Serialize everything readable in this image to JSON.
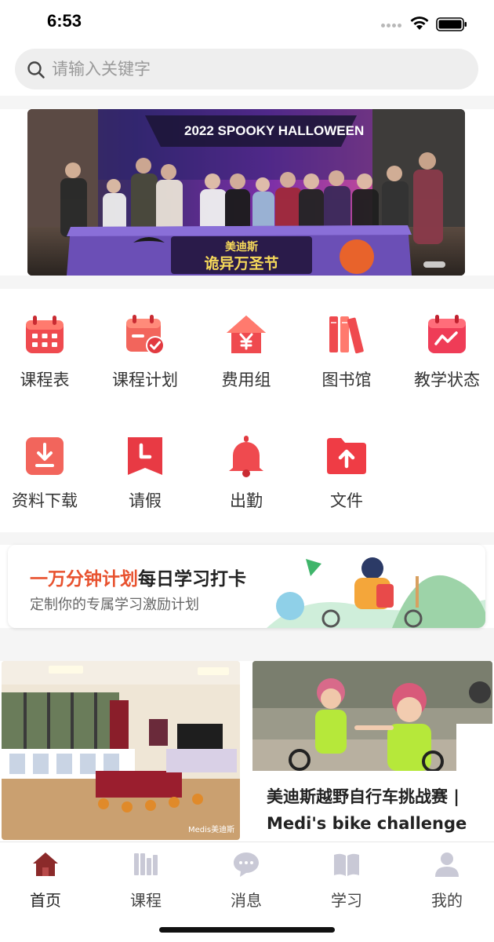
{
  "status_bar": {
    "time": "6:53"
  },
  "search": {
    "placeholder": "请输入关键字"
  },
  "banner": {
    "headline": "2022 SPOOKY HALLOWEEN",
    "brand": "美迪斯",
    "caption": "诡异万圣节"
  },
  "grid": {
    "items": [
      {
        "label": "课程表",
        "icon": "calendar-grid-icon"
      },
      {
        "label": "课程计划",
        "icon": "calendar-check-icon"
      },
      {
        "label": "费用组",
        "icon": "yen-house-icon"
      },
      {
        "label": "图书馆",
        "icon": "books-icon"
      },
      {
        "label": "教学状态",
        "icon": "calendar-trend-icon"
      },
      {
        "label": "资料下载",
        "icon": "download-icon"
      },
      {
        "label": "请假",
        "icon": "clock-leave-icon"
      },
      {
        "label": "出勤",
        "icon": "bell-icon"
      },
      {
        "label": "文件",
        "icon": "folder-upload-icon"
      }
    ]
  },
  "promo": {
    "title_highlight": "一万分钟计划",
    "title_rest": "每日学习打卡",
    "subtitle": "定制你的专属学习激励计划"
  },
  "cards": {
    "photo_watermark": "Medis美迪斯",
    "article_title": "美迪斯越野自行车挑战赛 | Medi's bike challenge"
  },
  "tabs": [
    {
      "label": "首页",
      "icon": "home-icon",
      "active": true
    },
    {
      "label": "课程",
      "icon": "library-icon",
      "active": false
    },
    {
      "label": "消息",
      "icon": "chat-bubble-icon",
      "active": false
    },
    {
      "label": "学习",
      "icon": "open-book-icon",
      "active": false
    },
    {
      "label": "我的",
      "icon": "user-icon",
      "active": false
    }
  ],
  "colors": {
    "accent_red": "#e8404a",
    "promo_orange": "#e8522f",
    "tab_active": "#8b2a2a",
    "tab_inactive": "#c9c9d6"
  }
}
